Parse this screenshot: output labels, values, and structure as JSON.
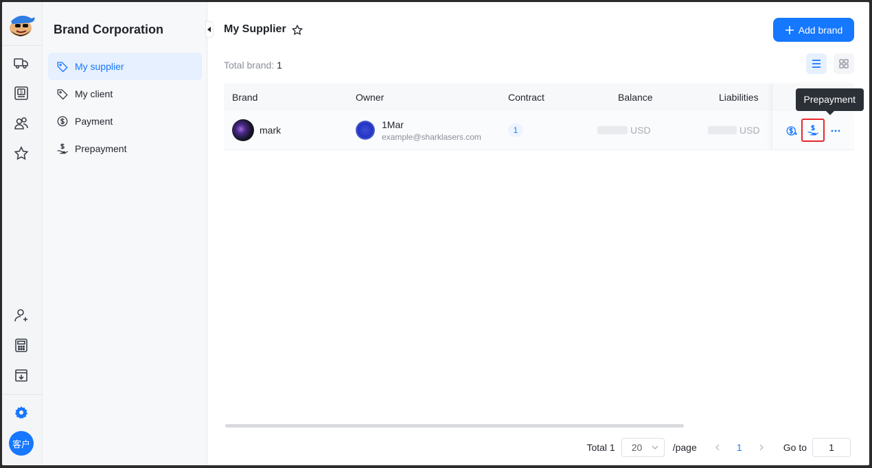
{
  "app": {
    "icons": [
      "truck-icon",
      "invoice-icon",
      "users-icon",
      "star-icon",
      "user-add-icon",
      "calculator-icon",
      "download-box-icon",
      "settings-icon"
    ],
    "avatar_text": "客户",
    "accent": "#1677ff"
  },
  "sidebar": {
    "title": "Brand Corporation",
    "items": [
      {
        "label": "My supplier",
        "icon": "tag-icon",
        "active": true
      },
      {
        "label": "My client",
        "icon": "tag-icon",
        "active": false
      },
      {
        "label": "Payment",
        "icon": "dollar-circle-icon",
        "active": false
      },
      {
        "label": "Prepayment",
        "icon": "hand-dollar-icon",
        "active": false
      }
    ]
  },
  "main": {
    "title": "My Supplier",
    "add_button": "Add brand",
    "total_label": "Total brand:",
    "total_value": "1"
  },
  "table": {
    "columns": [
      "Brand",
      "Owner",
      "Contract",
      "Balance",
      "Liabilities"
    ],
    "rows": [
      {
        "brand": "mark",
        "owner_name": "1Mar",
        "owner_email": "example@sharklasers.com",
        "contract": "1",
        "balance_currency": "USD",
        "liabilities_currency": "USD"
      }
    ]
  },
  "tooltip": "Prepayment",
  "pagination": {
    "total_text": "Total 1",
    "page_size": "20",
    "per_page": "/page",
    "current_page": "1",
    "goto_label": "Go to",
    "goto_value": "1"
  }
}
